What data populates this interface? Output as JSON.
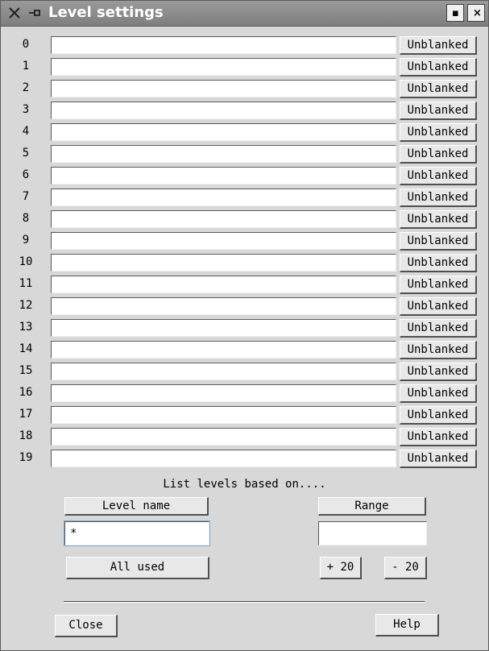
{
  "window": {
    "title": "Level settings",
    "menu_icon": "close-x-icon",
    "pin_icon": "pin-icon",
    "minimize_label": "▪",
    "close_label": "×"
  },
  "levels": [
    {
      "number": "0",
      "value": "",
      "button": "Unblanked"
    },
    {
      "number": "1",
      "value": "",
      "button": "Unblanked"
    },
    {
      "number": "2",
      "value": "",
      "button": "Unblanked"
    },
    {
      "number": "3",
      "value": "",
      "button": "Unblanked"
    },
    {
      "number": "4",
      "value": "",
      "button": "Unblanked"
    },
    {
      "number": "5",
      "value": "",
      "button": "Unblanked"
    },
    {
      "number": "6",
      "value": "",
      "button": "Unblanked"
    },
    {
      "number": "7",
      "value": "",
      "button": "Unblanked"
    },
    {
      "number": "8",
      "value": "",
      "button": "Unblanked"
    },
    {
      "number": "9",
      "value": "",
      "button": "Unblanked"
    },
    {
      "number": "10",
      "value": "",
      "button": "Unblanked"
    },
    {
      "number": "11",
      "value": "",
      "button": "Unblanked"
    },
    {
      "number": "12",
      "value": "",
      "button": "Unblanked"
    },
    {
      "number": "13",
      "value": "",
      "button": "Unblanked"
    },
    {
      "number": "14",
      "value": "",
      "button": "Unblanked"
    },
    {
      "number": "15",
      "value": "",
      "button": "Unblanked"
    },
    {
      "number": "16",
      "value": "",
      "button": "Unblanked"
    },
    {
      "number": "17",
      "value": "",
      "button": "Unblanked"
    },
    {
      "number": "18",
      "value": "",
      "button": "Unblanked"
    },
    {
      "number": "19",
      "value": "",
      "button": "Unblanked"
    }
  ],
  "list_section": {
    "heading": "List levels based on....",
    "level_name_button": "Level name",
    "level_name_value": "*",
    "range_button": "Range",
    "range_value": "",
    "all_used_button": "All used",
    "plus_button": "+ 20",
    "minus_button": "- 20"
  },
  "footer": {
    "close_button": "Close",
    "help_button": "Help"
  }
}
